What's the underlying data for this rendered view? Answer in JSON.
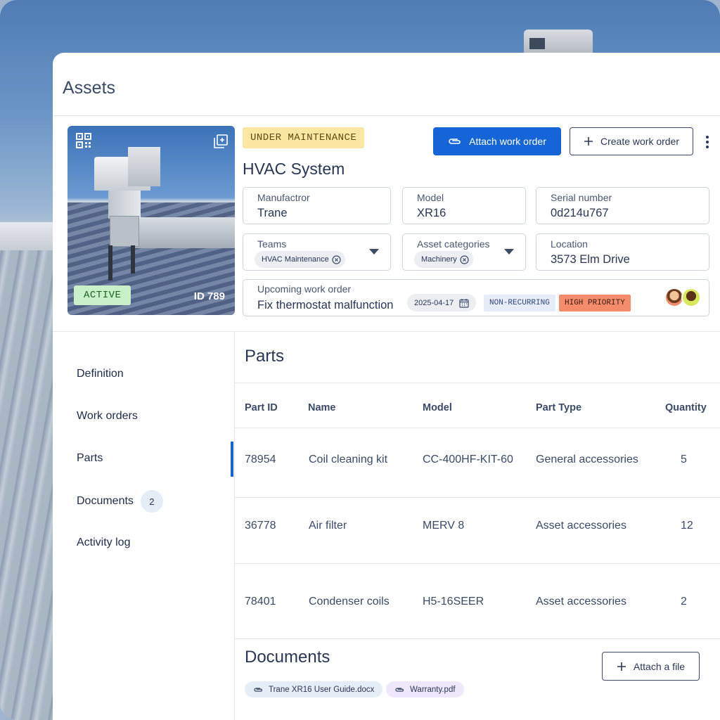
{
  "header": {
    "title": "Assets"
  },
  "asset": {
    "status": "UNDER MAINTENANCE",
    "name": "HVAC System",
    "photo_status": "ACTIVE",
    "id_label": "ID 789",
    "actions": {
      "attach": "Attach work order",
      "create": "Create work order"
    },
    "fields": {
      "manufacturer": {
        "label": "Manufactror",
        "value": "Trane"
      },
      "model": {
        "label": "Model",
        "value": "XR16"
      },
      "serial": {
        "label": "Serial number",
        "value": "0d214u767"
      },
      "teams": {
        "label": "Teams",
        "chip": "HVAC Maintenance"
      },
      "categories": {
        "label": "Asset categories",
        "chip": "Machinery"
      },
      "location": {
        "label": "Location",
        "value": "3573 Elm Drive"
      }
    },
    "upcoming": {
      "label": "Upcoming work order",
      "value": "Fix thermostat malfunction",
      "date": "2025-04-17",
      "recurrence": "NON-RECURRING",
      "priority": "HIGH PRIORITY"
    }
  },
  "sidebar": {
    "items": [
      {
        "label": "Definition"
      },
      {
        "label": "Work orders"
      },
      {
        "label": "Parts",
        "active": true
      },
      {
        "label": "Documents",
        "count": "2"
      },
      {
        "label": "Activity log"
      }
    ]
  },
  "parts": {
    "title": "Parts",
    "columns": [
      "Part ID",
      "Name",
      "Model",
      "Part Type",
      "Quantity"
    ],
    "rows": [
      [
        "78954",
        "Coil cleaning kit",
        "CC-400HF-KIT-60",
        "General accessories",
        "5"
      ],
      [
        "36778",
        "Air filter",
        "MERV 8",
        "Asset accessories",
        "12"
      ],
      [
        "78401",
        "Condenser coils",
        "H5-16SEER",
        "Asset accessories",
        "2"
      ]
    ]
  },
  "documents": {
    "title": "Documents",
    "attach_label": "Attach a file",
    "files": [
      "Trane XR16 User Guide.docx",
      "Warranty.pdf"
    ]
  },
  "colors": {
    "primary": "#1565d8",
    "active": "#c9f1c9",
    "maintenance": "#fbe6a2",
    "priority": "#f48c6c"
  }
}
